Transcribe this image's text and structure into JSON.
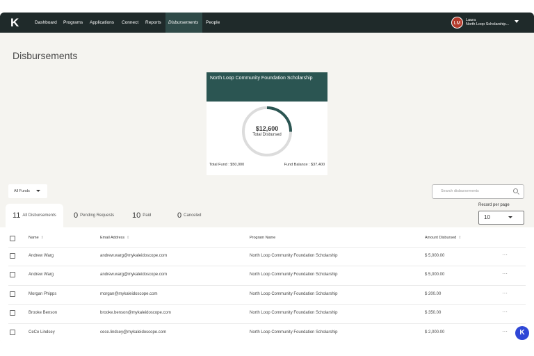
{
  "nav": {
    "logo": "K",
    "items": [
      "Dashboard",
      "Programs",
      "Applications",
      "Connect",
      "Reports",
      "Disbursements",
      "People"
    ],
    "active": "Disbursements"
  },
  "user": {
    "initials": "LM",
    "name": "Laura",
    "org": "North Loop Scholarship..."
  },
  "page": {
    "title": "Disbursements"
  },
  "fund_card": {
    "name": "North Loop Community Foundation Scholarship",
    "amount": "$12,600",
    "amount_label": "Total Disbursed",
    "total_fund": "Total Fund : $50,000",
    "fund_balance": "Fund Balance : $37,400",
    "disbursed_fraction": 0.252,
    "ring_color": "#2b5552",
    "track_color": "#dcdcdc"
  },
  "filters": {
    "funds_label": "All Funds",
    "search_placeholder": "Search disbursements",
    "records_label": "Record per page",
    "records_value": "10"
  },
  "tabs": [
    {
      "count": "11",
      "label": "All Disbursements"
    },
    {
      "count": "0",
      "label": "Pending Requests"
    },
    {
      "count": "10",
      "label": "Paid"
    },
    {
      "count": "0",
      "label": "Canceled"
    }
  ],
  "table": {
    "columns": [
      "Name",
      "Email Address",
      "Program Name",
      "Amount Disbursed"
    ],
    "rows": [
      {
        "name": "Andrew Warg",
        "email": "andrew.warg@mykaleidoscope.com",
        "program": "North Loop Community Foundation Scholarship",
        "amount": "$ 5,000.00"
      },
      {
        "name": "Andrew Warg",
        "email": "andrew.warg@mykaleidoscope.com",
        "program": "North Loop Community Foundation Scholarship",
        "amount": "$ 5,000.00"
      },
      {
        "name": "Morgan Phipps",
        "email": "morgan@mykaleidoscope.com",
        "program": "North Loop Community Foundation Scholarship",
        "amount": "$ 200.00"
      },
      {
        "name": "Brooke Benson",
        "email": "brooke.benson@mykaleidoscope.com",
        "program": "North Loop Community Foundation Scholarship",
        "amount": "$ 350.00"
      },
      {
        "name": "CeCe Lindsey",
        "email": "cece.lindsey@mykaleidoscope.com",
        "program": "North Loop Community Foundation Scholarship",
        "amount": "$ 2,000.00"
      }
    ],
    "more_label": "···"
  },
  "help_fab": "K"
}
